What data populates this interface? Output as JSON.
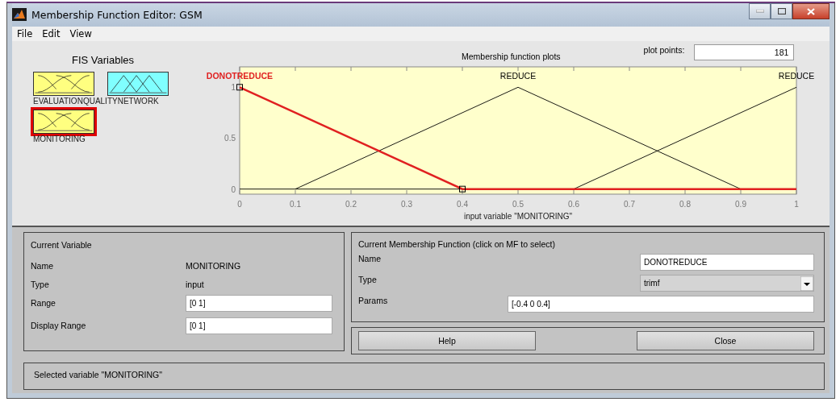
{
  "window": {
    "title": "Membership Function Editor: GSM"
  },
  "menu": [
    "File",
    "Edit",
    "View"
  ],
  "fis_variables": {
    "title": "FIS Variables",
    "items": [
      {
        "name": "EVALUATION",
        "kind": "input",
        "selected": false
      },
      {
        "name": "QUALITYNETWORK",
        "kind": "output",
        "selected": false
      },
      {
        "name": "MONITORING",
        "kind": "input",
        "selected": true
      }
    ]
  },
  "plot": {
    "title": "Membership function plots",
    "plot_points_label": "plot points:",
    "plot_points": "181",
    "chart_data": {
      "type": "line",
      "xlabel": "input variable \"MONITORING\"",
      "x": [
        0,
        0.1,
        0.4,
        0.5,
        0.6,
        0.9,
        1
      ],
      "xlim": [
        0,
        1
      ],
      "ylim": [
        -0.05,
        1.2
      ],
      "xticks": [
        0,
        0.1,
        0.2,
        0.3,
        0.4,
        0.5,
        0.6,
        0.7,
        0.8,
        0.9,
        1
      ],
      "yticks": [
        0,
        0.5,
        1
      ],
      "series": [
        {
          "name": "DONOTREDUCE",
          "color": "#e02020",
          "values": [
            1,
            0.75,
            0,
            0,
            0,
            0,
            0
          ]
        },
        {
          "name": "REDUCE",
          "color": "#000000",
          "values": [
            null,
            0,
            0.75,
            1,
            0.75,
            0,
            null
          ]
        },
        {
          "name": "REDUCE",
          "color": "#000000",
          "values": [
            null,
            null,
            null,
            null,
            0,
            0.75,
            1
          ]
        }
      ]
    },
    "membership_functions": [
      {
        "selected": true
      },
      {
        "selected": false
      },
      {
        "selected": false
      }
    ]
  },
  "current_variable": {
    "title": "Current Variable",
    "name_label": "Name",
    "name": "MONITORING",
    "type_label": "Type",
    "type": "input",
    "range_label": "Range",
    "range": "[0 1]",
    "display_range_label": "Display Range",
    "display_range": "[0 1]"
  },
  "current_mf": {
    "title": "Current Membership Function (click on MF to select)",
    "name_label": "Name",
    "name": "DONOTREDUCE",
    "type_label": "Type",
    "type": "trimf",
    "params_label": "Params",
    "params": "[-0.4 0 0.4]"
  },
  "buttons": [
    "Help",
    "Close"
  ],
  "status": "Selected variable \"MONITORING\""
}
